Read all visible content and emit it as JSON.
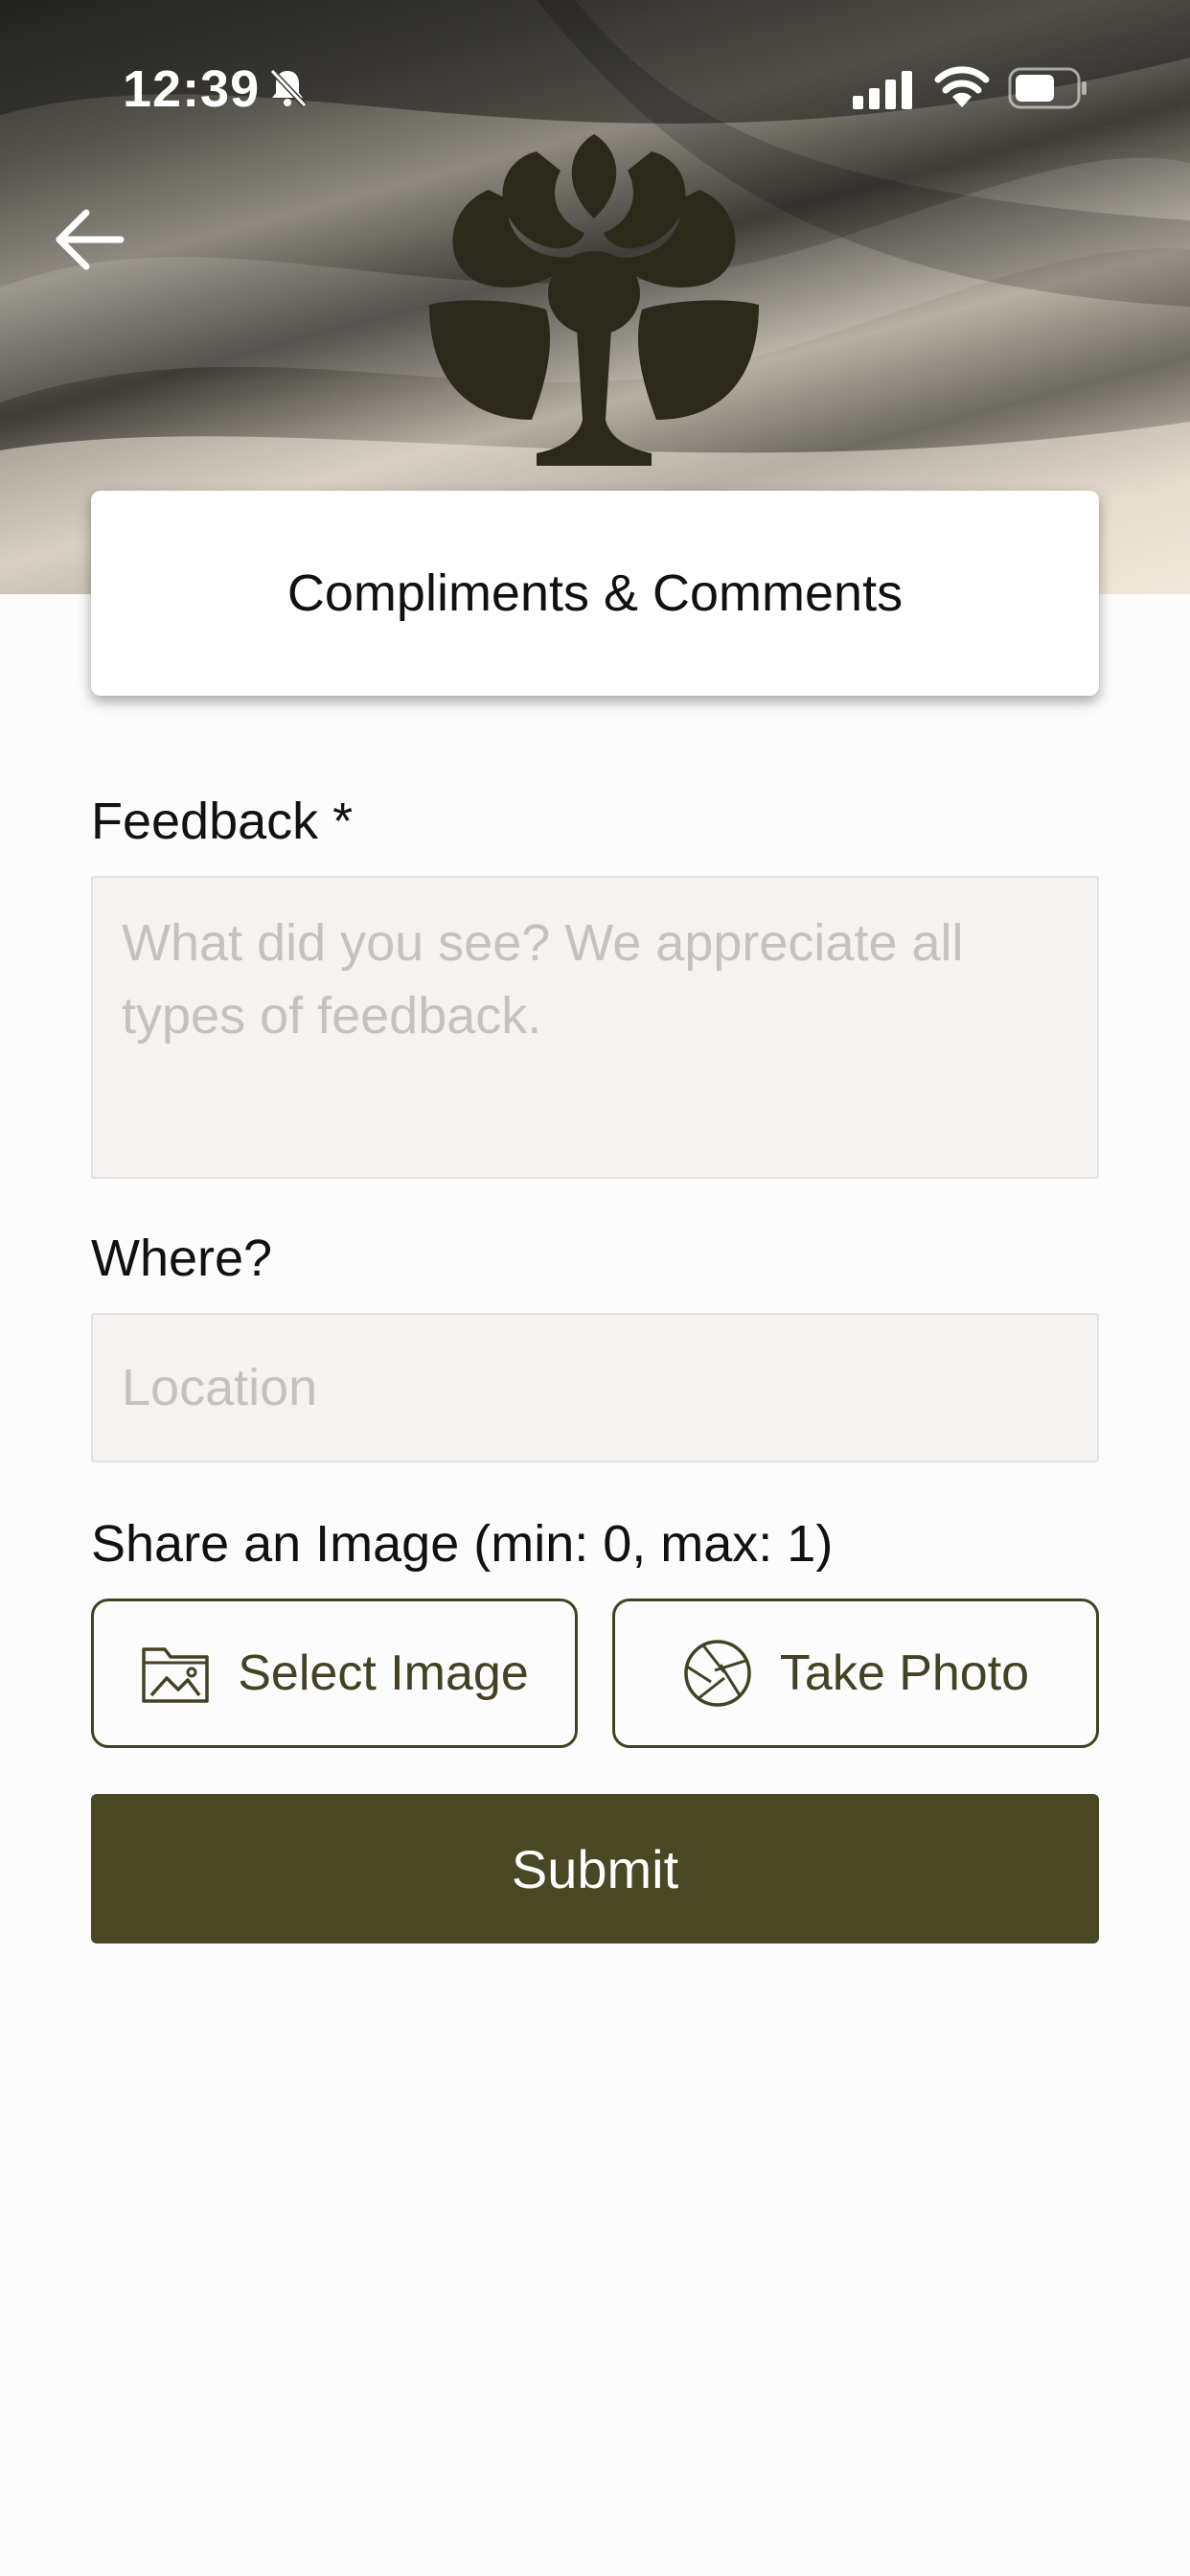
{
  "status_bar": {
    "time": "12:39",
    "icons": [
      "bell-slash-icon",
      "signal-icon",
      "wifi-icon",
      "battery-icon"
    ]
  },
  "header": {
    "back_icon": "arrow-left-icon",
    "logo": "lotus-tree-emblem"
  },
  "title": "Compliments & Comments",
  "form": {
    "feedback_label": "Feedback *",
    "feedback_placeholder": "What did you see? We appreciate all types of feedback.",
    "feedback_value": "",
    "where_label": "Where?",
    "location_placeholder": "Location",
    "location_value": "",
    "image_label": "Share an Image (min: 0, max: 1)",
    "select_image_label": "Select Image",
    "take_photo_label": "Take Photo",
    "submit_label": "Submit"
  },
  "colors": {
    "accent": "#4a4725",
    "button_border": "#434224",
    "field_bg": "#f4f3f2",
    "logo": "#2b2a1a"
  }
}
